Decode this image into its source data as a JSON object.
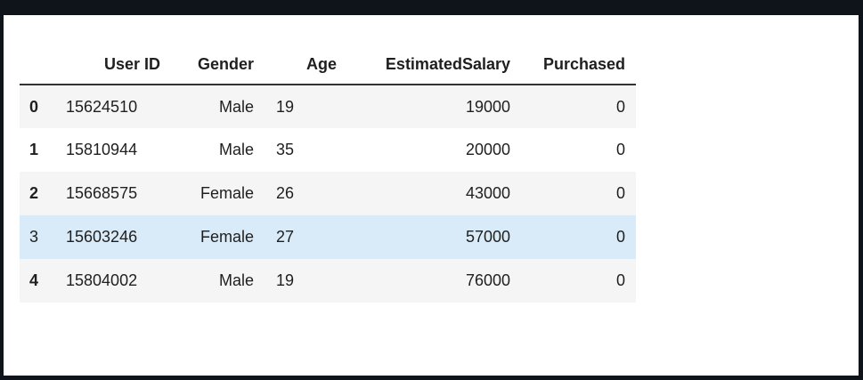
{
  "table": {
    "columns": [
      "User ID",
      "Gender",
      "Age",
      "EstimatedSalary",
      "Purchased"
    ],
    "rows": [
      {
        "index": "0",
        "user_id": "15624510",
        "gender": "Male",
        "age": "19",
        "salary": "19000",
        "purchased": "0"
      },
      {
        "index": "1",
        "user_id": "15810944",
        "gender": "Male",
        "age": "35",
        "salary": "20000",
        "purchased": "0"
      },
      {
        "index": "2",
        "user_id": "15668575",
        "gender": "Female",
        "age": "26",
        "salary": "43000",
        "purchased": "0"
      },
      {
        "index": "3",
        "user_id": "15603246",
        "gender": "Female",
        "age": "27",
        "salary": "57000",
        "purchased": "0"
      },
      {
        "index": "4",
        "user_id": "15804002",
        "gender": "Male",
        "age": "19",
        "salary": "76000",
        "purchased": "0"
      }
    ],
    "hovered_row": 3
  },
  "colors": {
    "page_background": "#0f131a",
    "panel_background": "#ffffff",
    "row_stripe": "#f5f5f5",
    "row_hover": "#d9ebf8"
  }
}
